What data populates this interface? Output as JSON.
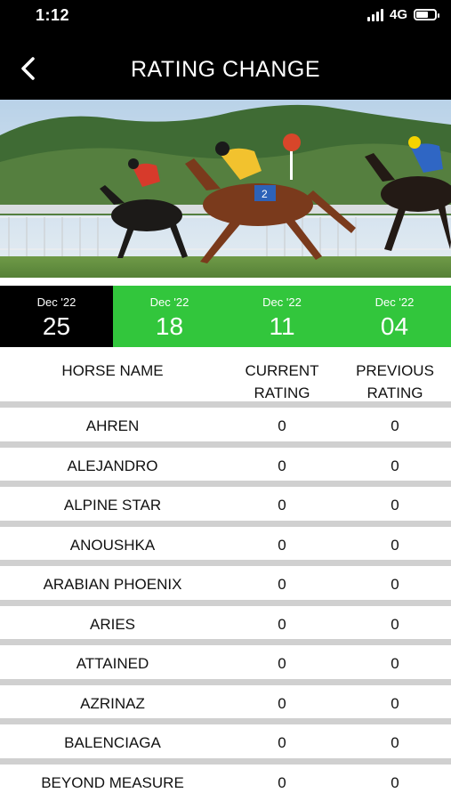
{
  "status_bar": {
    "time": "1:12",
    "network": "4G"
  },
  "header": {
    "title": "RATING CHANGE"
  },
  "date_tabs": [
    {
      "month": "Dec '22",
      "day": "25",
      "active": true
    },
    {
      "month": "Dec '22",
      "day": "18",
      "active": false
    },
    {
      "month": "Dec '22",
      "day": "11",
      "active": false
    },
    {
      "month": "Dec '22",
      "day": "04",
      "active": false
    }
  ],
  "table": {
    "headers": {
      "name": "HORSE NAME",
      "current": "CURRENT\nRATING",
      "previous": "PREVIOUS\nRATING"
    },
    "rows": [
      {
        "name": "AHREN",
        "current": "0",
        "previous": "0"
      },
      {
        "name": "ALEJANDRO",
        "current": "0",
        "previous": "0"
      },
      {
        "name": "ALPINE STAR",
        "current": "0",
        "previous": "0"
      },
      {
        "name": "ANOUSHKA",
        "current": "0",
        "previous": "0"
      },
      {
        "name": "ARABIAN PHOENIX",
        "current": "0",
        "previous": "0"
      },
      {
        "name": "ARIES",
        "current": "0",
        "previous": "0"
      },
      {
        "name": "ATTAINED",
        "current": "0",
        "previous": "0"
      },
      {
        "name": "AZRINAZ",
        "current": "0",
        "previous": "0"
      },
      {
        "name": "BALENCIAGA",
        "current": "0",
        "previous": "0"
      },
      {
        "name": "BEYOND MEASURE",
        "current": "0",
        "previous": "0"
      }
    ]
  },
  "colors": {
    "header_bg": "#000000",
    "tab_active_bg": "#000000",
    "tab_bg": "#32c63c",
    "divider": "#d0d0d0"
  },
  "icons": {
    "back": "chevron-left-icon",
    "signal": "signal-icon",
    "battery": "battery-icon"
  }
}
